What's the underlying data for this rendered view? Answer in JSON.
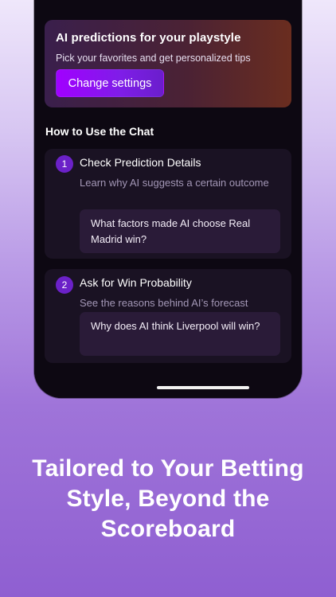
{
  "promo": {
    "title": "AI predictions for your playstyle",
    "subtitle": "Pick your favorites and get personalized tips",
    "button_label": "Change settings"
  },
  "chat_guide": {
    "title": "How to Use the Chat",
    "steps": [
      {
        "number": "1",
        "title": "Check Prediction Details",
        "subtitle": "Learn why AI suggests a certain outcome",
        "example": "What factors made AI choose Real Madrid win?"
      },
      {
        "number": "2",
        "title": "Ask for Win Probability",
        "subtitle": "See the reasons behind AI’s forecast",
        "example": "Why does AI think Liverpool will win?"
      }
    ]
  },
  "hero": {
    "headline": "Tailored to Your Betting Style, Beyond the Scoreboard"
  }
}
